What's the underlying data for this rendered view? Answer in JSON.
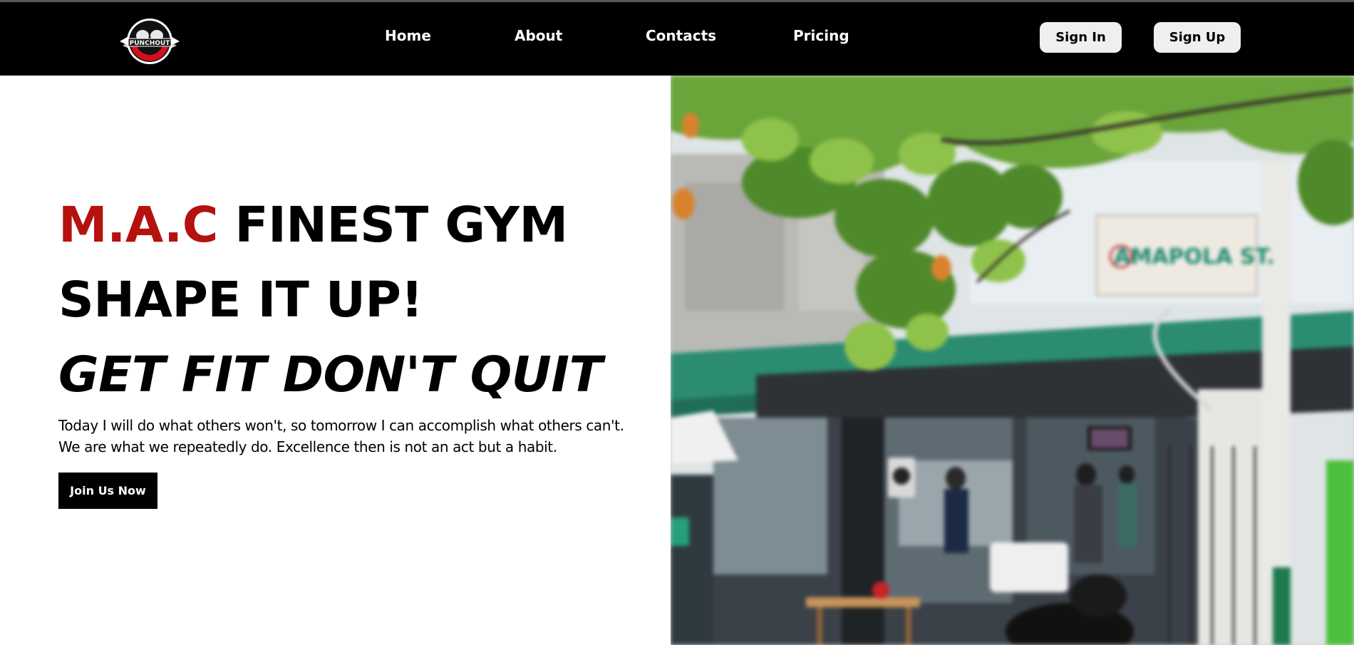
{
  "navbar": {
    "logo": {
      "icon": "punch-out-gym-logo",
      "text": "PUNCHOUT"
    },
    "links": [
      {
        "label": "Home"
      },
      {
        "label": "About"
      },
      {
        "label": "Contacts"
      },
      {
        "label": "Pricing"
      }
    ],
    "sign_in_label": "Sign In",
    "sign_up_label": "Sign Up"
  },
  "hero": {
    "headline_brand": "M.A.C",
    "headline_rest": " FINEST GYM",
    "headline_line2": "SHAPE IT UP!",
    "headline_line3": "GET FIT DON'T QUIT",
    "tagline_line1": "Today I will do what others won't, so tomorrow I can accomplish what others can't.",
    "tagline_line2": "We are what we repeatedly do. Excellence then is not an act but a habit.",
    "cta_label": "Join Us Now",
    "image": {
      "description_icon": "gym-storefront-photo",
      "street_sign_text": "AMAPOLA ST."
    }
  },
  "colors": {
    "navbar_bg": "#000000",
    "brand_red": "#b5110f",
    "button_light": "#efefef",
    "cta_bg": "#000000"
  }
}
